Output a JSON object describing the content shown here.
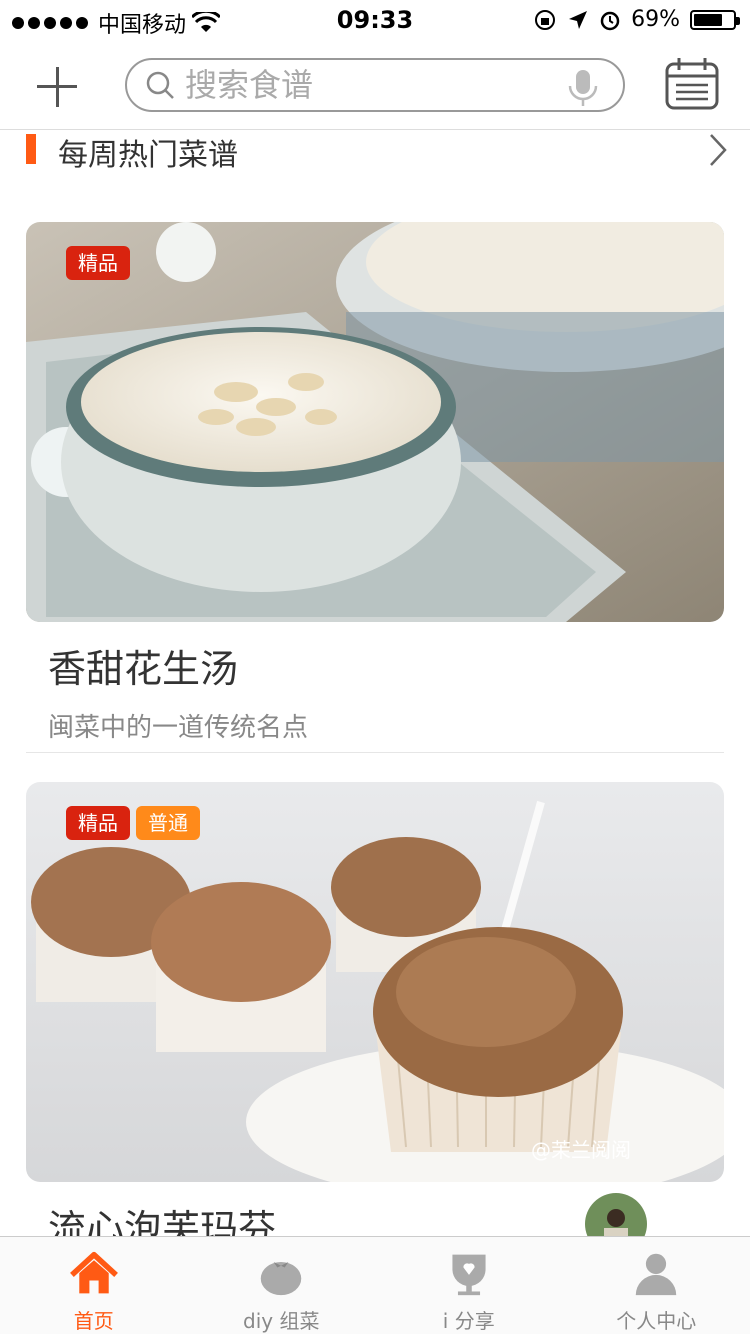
{
  "status_bar": {
    "carrier": "中国移动",
    "time": "09:33",
    "battery": "69%"
  },
  "header": {
    "search_placeholder": "搜索食谱"
  },
  "section": {
    "title": "每周热门菜谱"
  },
  "recipes": [
    {
      "name": "香甜花生汤",
      "desc": "闽菜中的一道传统名点",
      "tags": [
        "精品"
      ]
    },
    {
      "name": "流心泡芙玛芬",
      "desc": "",
      "tags": [
        "精品",
        "普通"
      ],
      "watermark": "@茉兰阅阅"
    }
  ],
  "tabs": [
    {
      "label": "首页",
      "icon": "home-icon",
      "active": true
    },
    {
      "label": "diy 组菜",
      "icon": "tomato-icon",
      "active": false
    },
    {
      "label": "i 分享",
      "icon": "share-cup-icon",
      "active": false
    },
    {
      "label": "个人中心",
      "icon": "person-icon",
      "active": false
    }
  ],
  "colors": {
    "accent": "#ff5a14",
    "tag_premium": "#d9230f",
    "tag_normal": "#ff8a1a"
  }
}
